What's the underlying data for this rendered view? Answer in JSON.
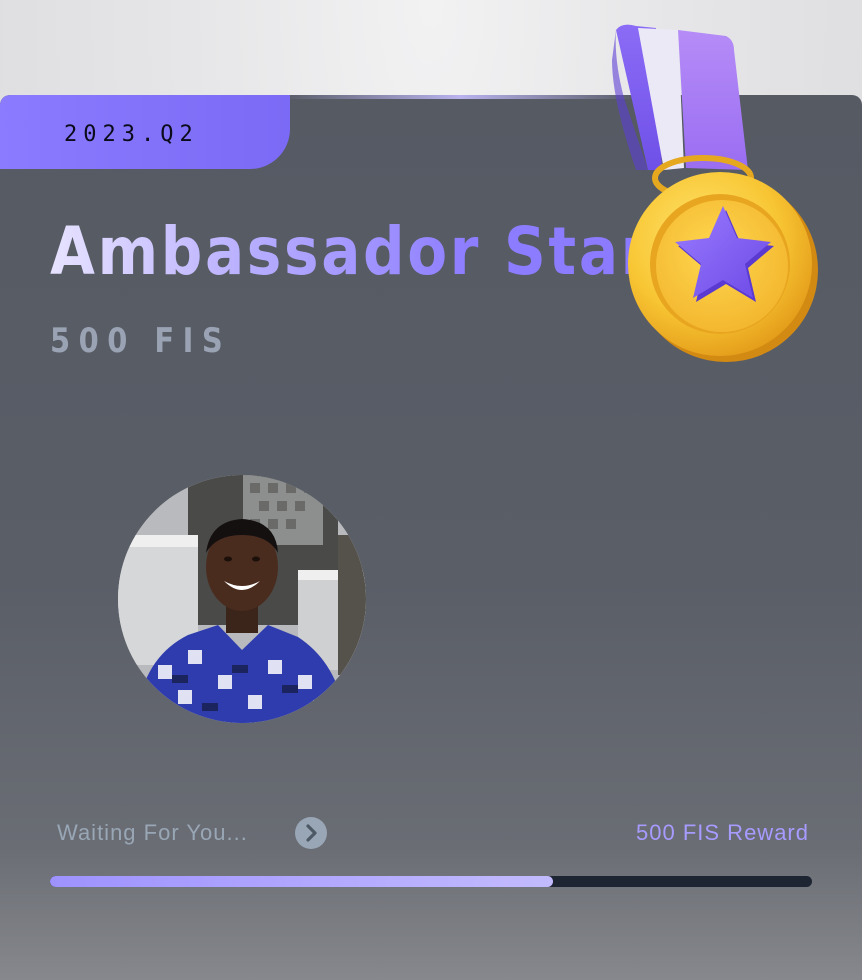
{
  "card": {
    "quarter": "2023.Q2",
    "title": "Ambassador Star",
    "amount": "500 FIS"
  },
  "medal": {
    "icon": "star-medal-icon"
  },
  "avatar": {
    "icon": "profile-photo"
  },
  "status": {
    "text": "Waiting For You...",
    "arrow_icon": "chevron-right-icon",
    "reward": "500 FIS Reward"
  },
  "progress": {
    "fraction": 0.66
  },
  "colors": {
    "accent": "#8b7aff",
    "card_bg": "#585c65",
    "muted_text": "#98a6b5",
    "reward_text": "#a69bff",
    "medal_gold": "#f3b72a",
    "medal_star": "#7d5cf0"
  }
}
